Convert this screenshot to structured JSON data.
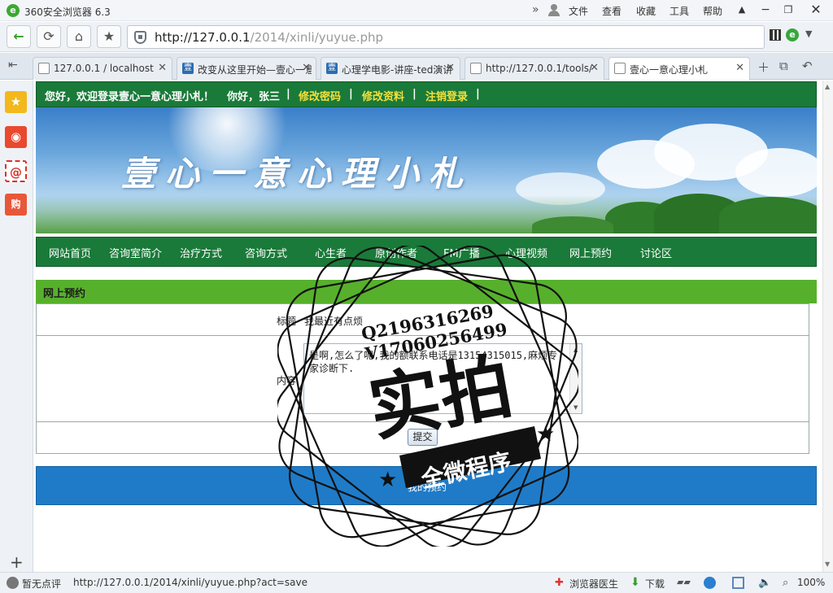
{
  "browser": {
    "app_title": "360安全浏览器 6.3",
    "menu": [
      "文件",
      "查看",
      "收藏",
      "工具",
      "帮助"
    ],
    "address": {
      "host": "http://127.0.0.1",
      "path": "/2014/xinli/yuyue.php"
    },
    "tabs": [
      {
        "label": "127.0.0.1 / localhost",
        "active": false
      },
      {
        "label": "改变从这里开始—壹心一意",
        "active": false
      },
      {
        "label": "心理学电影-讲座-ted演讲",
        "active": false
      },
      {
        "label": "http://127.0.0.1/tools/",
        "active": false
      },
      {
        "label": "壹心一意心理小札",
        "active": true
      }
    ],
    "favicon_text": "壹",
    "status": {
      "rating": "暂无点评",
      "hover_url": "http://127.0.0.1/2014/xinli/yuyue.php?act=save",
      "doctor": "浏览器医生",
      "download": "下载",
      "zoom": "100%"
    },
    "sidebar_icons": {
      "mail": "@",
      "shop": "购"
    }
  },
  "site": {
    "welcome": "您好，欢迎登录壹心一意心理小札！",
    "greeting": "你好，张三",
    "sep": "|",
    "links": [
      "修改密码",
      "修改资料",
      "注销登录"
    ],
    "banner_title": "壹心一意心理小札",
    "nav": [
      "网站首页",
      "咨询室简介",
      "治疗方式",
      "咨询方式",
      "心生者",
      "原创作者",
      "FM广播",
      "心理视频",
      "网上预约",
      "讨论区"
    ]
  },
  "booking": {
    "section_title": "网上预约",
    "title_label": "标题",
    "title_value": "我最近有点烦",
    "content_label": "内容",
    "content_value": "是啊,怎么了呢,我的额联系电话是13154315015,麻烦专家诊断下.",
    "submit_label": "提交",
    "my_orders_label": "我的预约"
  },
  "watermark": {
    "qq": "Q2196316269",
    "v": "V17060256499",
    "big": "实拍",
    "small": "全微程序"
  }
}
